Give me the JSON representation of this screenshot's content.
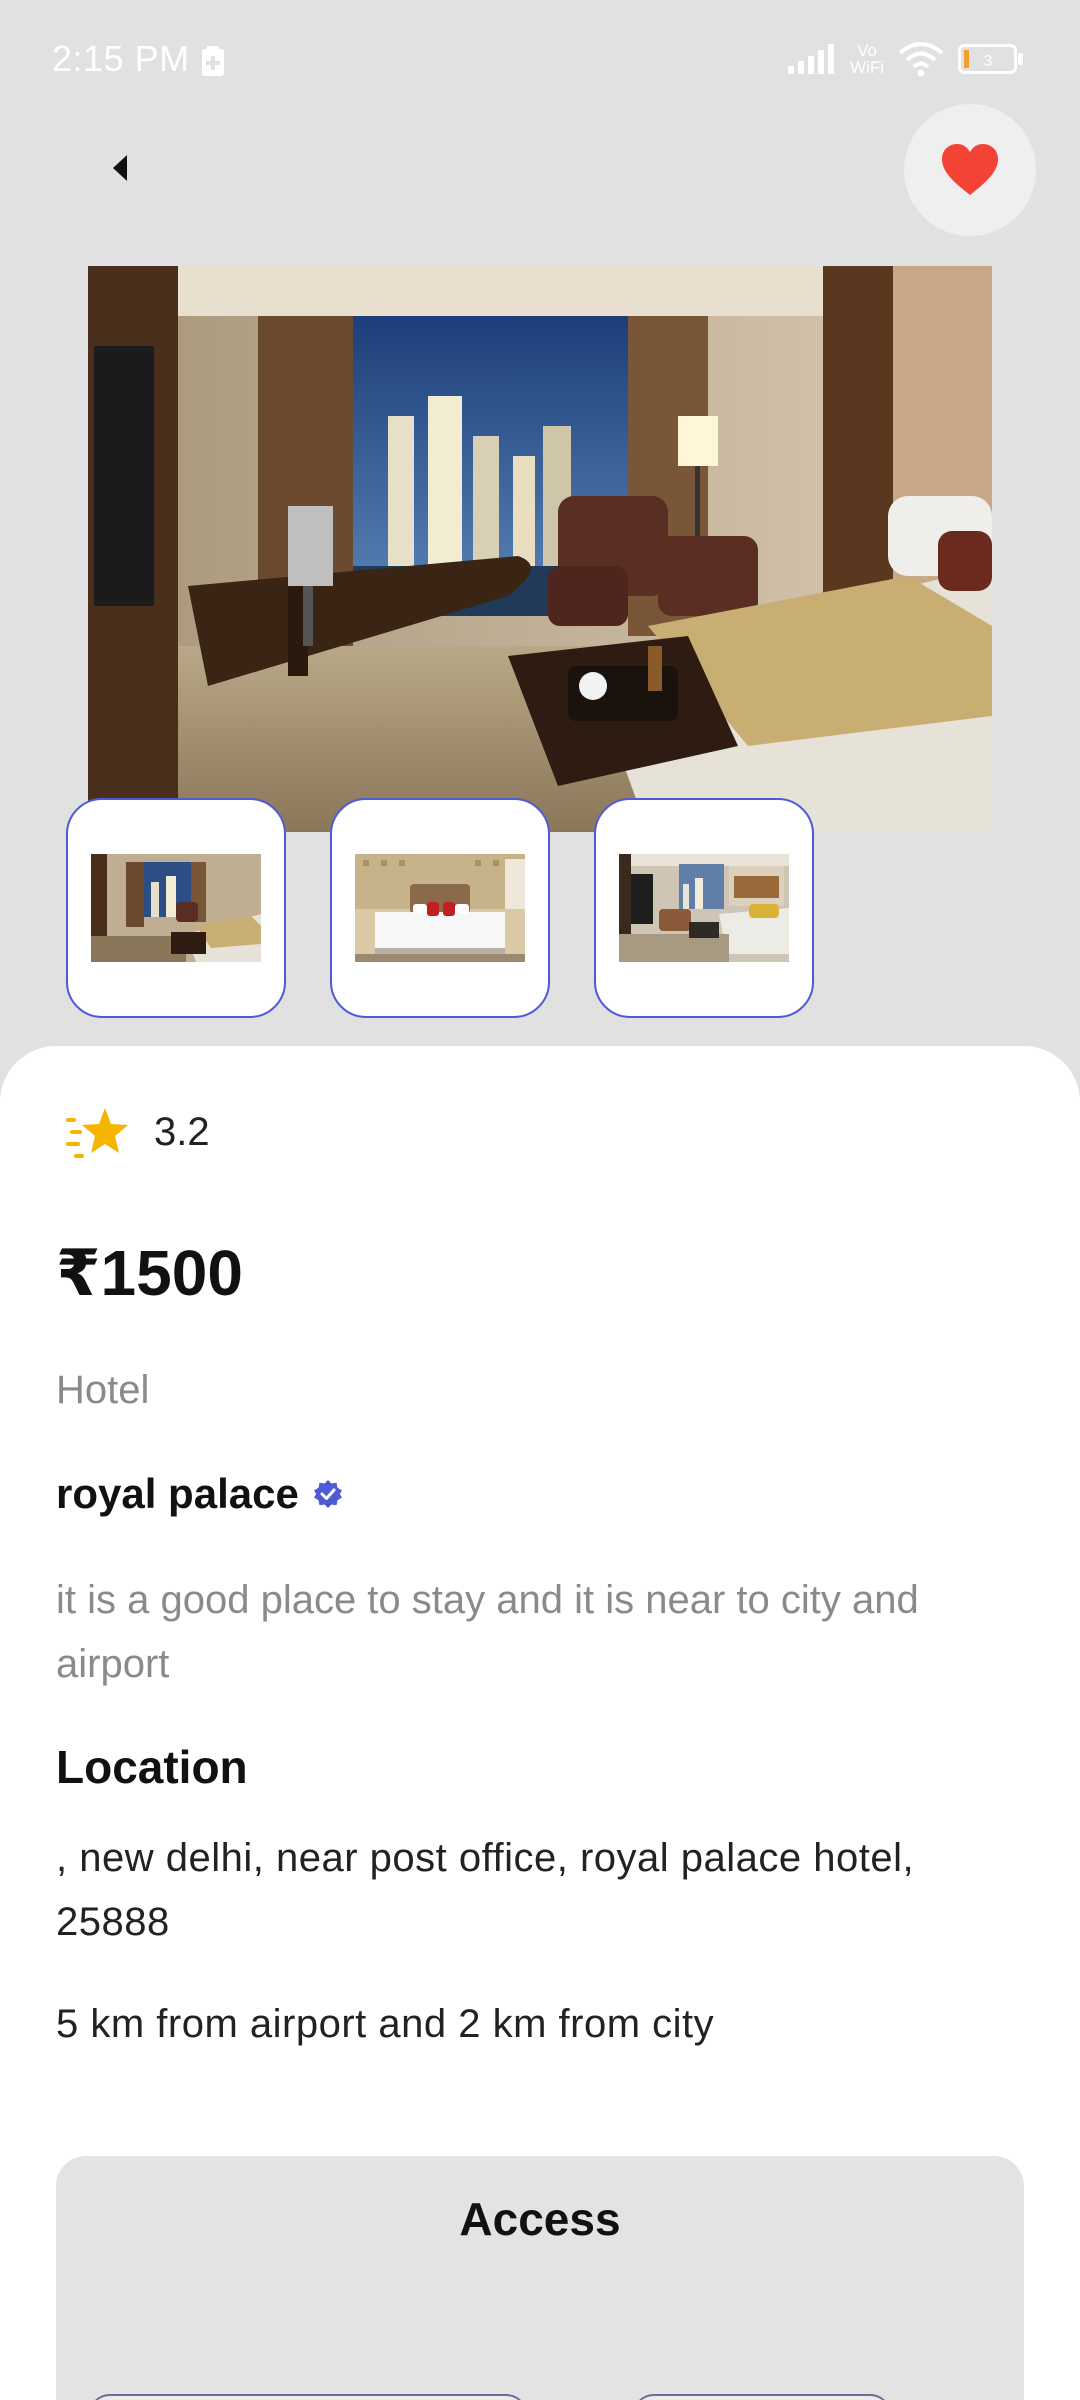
{
  "status_bar": {
    "time": "2:15 PM",
    "vowifi_top": "Vo",
    "vowifi_bottom": "WiFi",
    "battery_level": "3",
    "icons": [
      "battery-saver-icon",
      "signal-icon",
      "vowifi-icon",
      "wifi-icon",
      "battery-icon"
    ]
  },
  "header": {
    "back_icon": "back-arrow-icon",
    "favorite_icon": "heart-icon",
    "favorite_color": "#f44336"
  },
  "gallery": {
    "thumbnails": [
      {
        "name": "thumbnail-1"
      },
      {
        "name": "thumbnail-2"
      },
      {
        "name": "thumbnail-3"
      }
    ],
    "accent": "#4f5bd5"
  },
  "details": {
    "rating": "3.2",
    "price": "₹1500",
    "category": "Hotel",
    "name": "royal palace",
    "verified_color": "#4f5bd5",
    "description": "it is a good place to stay and it is near to city and airport",
    "location_heading": "Location",
    "address": ", new delhi, near post office, royal palace hotel, 25888",
    "distance": "5 km from airport and 2 km from city"
  },
  "access": {
    "title": "Access"
  }
}
